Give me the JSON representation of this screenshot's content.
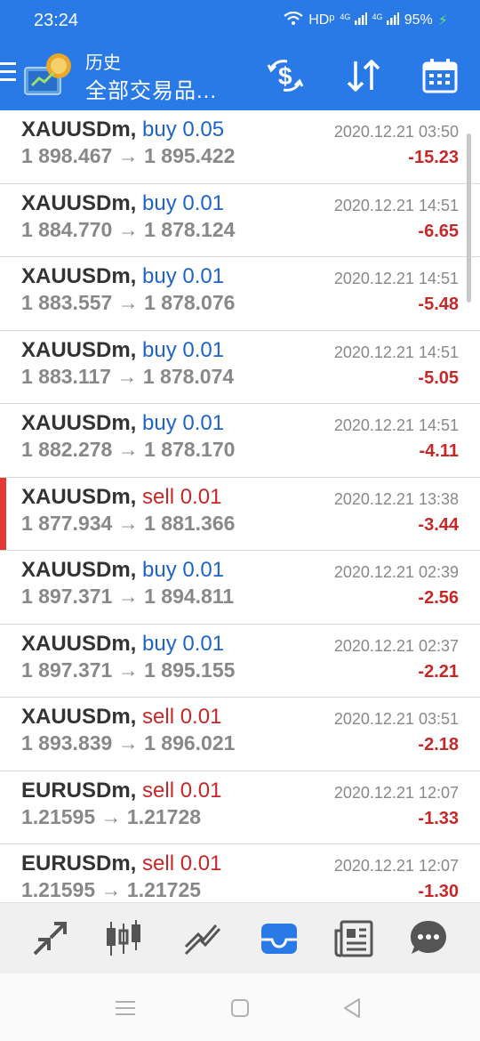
{
  "status_bar": {
    "time": "23:24",
    "network_label": "HDᵖ",
    "signal_label_1": "4G",
    "signal_label_2": "4G",
    "battery": "95%"
  },
  "app_bar": {
    "subtitle": "历史",
    "title": "全部交易品..."
  },
  "trades": [
    {
      "symbol": "XAUUSDm,",
      "side": "buy",
      "side_label": "buy 0.05",
      "open": "1 898.467",
      "close": "1 895.422",
      "time": "2020.12.21 03:50",
      "profit": "-15.23"
    },
    {
      "symbol": "XAUUSDm,",
      "side": "buy",
      "side_label": "buy 0.01",
      "open": "1 884.770",
      "close": "1 878.124",
      "time": "2020.12.21 14:51",
      "profit": "-6.65"
    },
    {
      "symbol": "XAUUSDm,",
      "side": "buy",
      "side_label": "buy 0.01",
      "open": "1 883.557",
      "close": "1 878.076",
      "time": "2020.12.21 14:51",
      "profit": "-5.48"
    },
    {
      "symbol": "XAUUSDm,",
      "side": "buy",
      "side_label": "buy 0.01",
      "open": "1 883.117",
      "close": "1 878.074",
      "time": "2020.12.21 14:51",
      "profit": "-5.05"
    },
    {
      "symbol": "XAUUSDm,",
      "side": "buy",
      "side_label": "buy 0.01",
      "open": "1 882.278",
      "close": "1 878.170",
      "time": "2020.12.21 14:51",
      "profit": "-4.11"
    },
    {
      "symbol": "XAUUSDm,",
      "side": "sell",
      "side_label": "sell 0.01",
      "open": "1 877.934",
      "close": "1 881.366",
      "time": "2020.12.21 13:38",
      "profit": "-3.44"
    },
    {
      "symbol": "XAUUSDm,",
      "side": "buy",
      "side_label": "buy 0.01",
      "open": "1 897.371",
      "close": "1 894.811",
      "time": "2020.12.21 02:39",
      "profit": "-2.56"
    },
    {
      "symbol": "XAUUSDm,",
      "side": "buy",
      "side_label": "buy 0.01",
      "open": "1 897.371",
      "close": "1 895.155",
      "time": "2020.12.21 02:37",
      "profit": "-2.21"
    },
    {
      "symbol": "XAUUSDm,",
      "side": "sell",
      "side_label": "sell 0.01",
      "open": "1 893.839",
      "close": "1 896.021",
      "time": "2020.12.21 03:51",
      "profit": "-2.18"
    },
    {
      "symbol": "EURUSDm,",
      "side": "sell",
      "side_label": "sell 0.01",
      "open": "1.21595",
      "close": "1.21728",
      "time": "2020.12.21 12:07",
      "profit": "-1.33"
    },
    {
      "symbol": "EURUSDm,",
      "side": "sell",
      "side_label": "sell 0.01",
      "open": "1.21595",
      "close": "1.21725",
      "time": "2020.12.21 12:07",
      "profit": "-1.30"
    }
  ],
  "arrow": "→",
  "selected_index": 5,
  "bottom_nav": {
    "items": [
      "quotes-icon",
      "chart-icon",
      "trade-icon",
      "history-icon",
      "news-icon",
      "chat-icon"
    ],
    "active": "history-icon"
  },
  "colors": {
    "primary": "#2979e6",
    "buy": "#1e63c8",
    "sell": "#c62828",
    "profit_negative": "#c62828"
  }
}
